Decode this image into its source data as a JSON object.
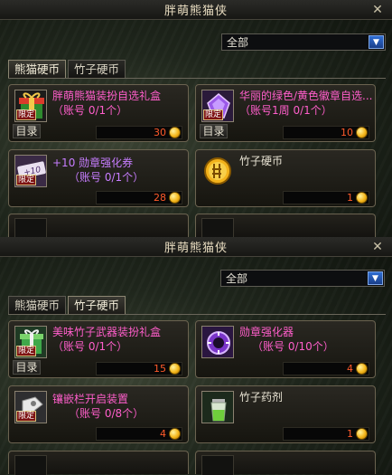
{
  "window_top": {
    "title": "胖萌熊猫侠",
    "filter": {
      "selected": "全部"
    },
    "tabs": [
      {
        "label": "熊猫硬币",
        "active": true
      },
      {
        "label": "竹子硬币",
        "active": false
      }
    ],
    "items": [
      {
        "name": "胖萌熊猫装扮自选礼盒",
        "limit": "（账号 0/1个）",
        "badge": "限定",
        "dir_label": "目录",
        "price": "30",
        "icon": "gift-box-icon",
        "name_color": "#ff5ecb"
      },
      {
        "name": "华丽的绿色/黄色徽章自选...",
        "limit": "（账号1周 0/1个）",
        "badge": "限定",
        "dir_label": "目录",
        "price": "10",
        "icon": "purple-gem-icon",
        "name_color": "#ff5ecb"
      },
      {
        "name": "+10 勋章强化券",
        "limit": "（账号 0/1个）",
        "badge": "限定",
        "price": "28",
        "icon": "ticket-icon",
        "name_color": "#c77dff"
      },
      {
        "name": "竹子硬币",
        "limit": "",
        "price": "1",
        "icon": "bamboo-coin-icon",
        "name_color": "#e8e3d3"
      }
    ]
  },
  "window_bottom": {
    "title": "胖萌熊猫侠",
    "filter": {
      "selected": "全部"
    },
    "tabs": [
      {
        "label": "熊猫硬币",
        "active": false
      },
      {
        "label": "竹子硬币",
        "active": true
      }
    ],
    "items": [
      {
        "name": "美味竹子武器装扮礼盒",
        "limit": "（账号 0/1个）",
        "badge": "限定",
        "dir_label": "目录",
        "price": "15",
        "icon": "bamboo-gift-icon",
        "name_color": "#ff5ecb"
      },
      {
        "name": "勋章强化器",
        "limit": "（账号 0/10个）",
        "price": "4",
        "icon": "medal-enhancer-icon",
        "name_color": "#ff5ecb"
      },
      {
        "name": "镶嵌栏开启装置",
        "limit": "（账号 0/8个）",
        "badge": "限定",
        "price": "4",
        "icon": "socket-opener-icon",
        "name_color": "#ff5ecb"
      },
      {
        "name": "竹子药剂",
        "limit": "",
        "price": "1",
        "icon": "potion-icon",
        "name_color": "#e8e3d3"
      }
    ]
  },
  "colors": {
    "price_red": "#ff5a2a",
    "item_pink": "#ff5ecb",
    "item_violet": "#c77dff",
    "dropdown_blue": "#2f6ed4"
  }
}
